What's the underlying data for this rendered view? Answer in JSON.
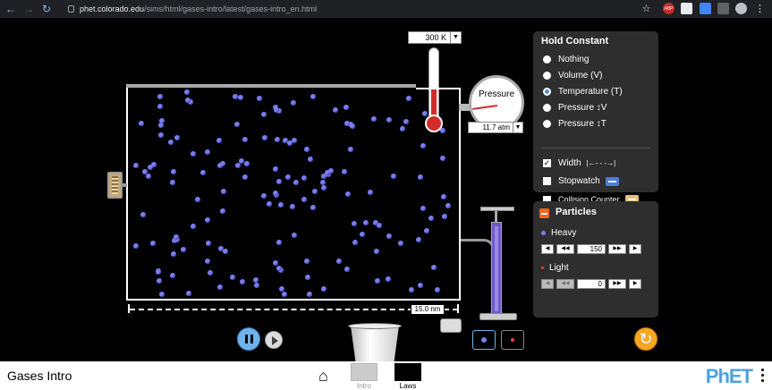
{
  "browser": {
    "url_host": "phet.colorado.edu",
    "url_path": "/sims/html/gases-intro/latest/gases-intro_en.html",
    "ext_abp": "ABP"
  },
  "sim": {
    "thermometer": {
      "value": "300 K",
      "level": 0.48
    },
    "pressure": {
      "title": "Pressure",
      "value": "11.7 atm"
    },
    "width": {
      "value": "15.0 nm"
    },
    "colors": {
      "heavy": "#7b7ef0",
      "light": "#f04040",
      "accent": "#f26522",
      "selected_radio": "#4a90d9"
    }
  },
  "hold_constant": {
    "title": "Hold Constant",
    "options": [
      {
        "label": "Nothing",
        "selected": false
      },
      {
        "label": "Volume (V)",
        "selected": false
      },
      {
        "label": "Temperature (T)",
        "selected": true
      },
      {
        "label": "Pressure ↕V",
        "selected": false
      },
      {
        "label": "Pressure ↕T",
        "selected": false
      }
    ],
    "checks": [
      {
        "label": "Width",
        "checked": true,
        "glyph": "|←- - -→|"
      },
      {
        "label": "Stopwatch",
        "checked": false
      },
      {
        "label": "Collision Counter",
        "checked": false
      }
    ]
  },
  "particles": {
    "title": "Particles",
    "heavy": {
      "label": "Heavy",
      "count": "150"
    },
    "light": {
      "label": "Light",
      "count": "0"
    }
  },
  "navbar": {
    "title": "Gases Intro",
    "screens": [
      {
        "label": "Intro"
      },
      {
        "label": "Laws"
      }
    ],
    "logo_a": "PhET",
    "logo_b": ""
  }
}
